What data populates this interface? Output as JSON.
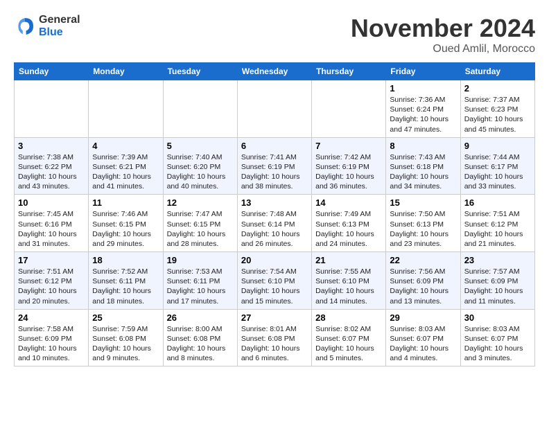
{
  "header": {
    "logo_general": "General",
    "logo_blue": "Blue",
    "month_title": "November 2024",
    "location": "Oued Amlil, Morocco"
  },
  "weekdays": [
    "Sunday",
    "Monday",
    "Tuesday",
    "Wednesday",
    "Thursday",
    "Friday",
    "Saturday"
  ],
  "weeks": [
    [
      {
        "day": "",
        "info": ""
      },
      {
        "day": "",
        "info": ""
      },
      {
        "day": "",
        "info": ""
      },
      {
        "day": "",
        "info": ""
      },
      {
        "day": "",
        "info": ""
      },
      {
        "day": "1",
        "info": "Sunrise: 7:36 AM\nSunset: 6:24 PM\nDaylight: 10 hours and 47 minutes."
      },
      {
        "day": "2",
        "info": "Sunrise: 7:37 AM\nSunset: 6:23 PM\nDaylight: 10 hours and 45 minutes."
      }
    ],
    [
      {
        "day": "3",
        "info": "Sunrise: 7:38 AM\nSunset: 6:22 PM\nDaylight: 10 hours and 43 minutes."
      },
      {
        "day": "4",
        "info": "Sunrise: 7:39 AM\nSunset: 6:21 PM\nDaylight: 10 hours and 41 minutes."
      },
      {
        "day": "5",
        "info": "Sunrise: 7:40 AM\nSunset: 6:20 PM\nDaylight: 10 hours and 40 minutes."
      },
      {
        "day": "6",
        "info": "Sunrise: 7:41 AM\nSunset: 6:19 PM\nDaylight: 10 hours and 38 minutes."
      },
      {
        "day": "7",
        "info": "Sunrise: 7:42 AM\nSunset: 6:19 PM\nDaylight: 10 hours and 36 minutes."
      },
      {
        "day": "8",
        "info": "Sunrise: 7:43 AM\nSunset: 6:18 PM\nDaylight: 10 hours and 34 minutes."
      },
      {
        "day": "9",
        "info": "Sunrise: 7:44 AM\nSunset: 6:17 PM\nDaylight: 10 hours and 33 minutes."
      }
    ],
    [
      {
        "day": "10",
        "info": "Sunrise: 7:45 AM\nSunset: 6:16 PM\nDaylight: 10 hours and 31 minutes."
      },
      {
        "day": "11",
        "info": "Sunrise: 7:46 AM\nSunset: 6:15 PM\nDaylight: 10 hours and 29 minutes."
      },
      {
        "day": "12",
        "info": "Sunrise: 7:47 AM\nSunset: 6:15 PM\nDaylight: 10 hours and 28 minutes."
      },
      {
        "day": "13",
        "info": "Sunrise: 7:48 AM\nSunset: 6:14 PM\nDaylight: 10 hours and 26 minutes."
      },
      {
        "day": "14",
        "info": "Sunrise: 7:49 AM\nSunset: 6:13 PM\nDaylight: 10 hours and 24 minutes."
      },
      {
        "day": "15",
        "info": "Sunrise: 7:50 AM\nSunset: 6:13 PM\nDaylight: 10 hours and 23 minutes."
      },
      {
        "day": "16",
        "info": "Sunrise: 7:51 AM\nSunset: 6:12 PM\nDaylight: 10 hours and 21 minutes."
      }
    ],
    [
      {
        "day": "17",
        "info": "Sunrise: 7:51 AM\nSunset: 6:12 PM\nDaylight: 10 hours and 20 minutes."
      },
      {
        "day": "18",
        "info": "Sunrise: 7:52 AM\nSunset: 6:11 PM\nDaylight: 10 hours and 18 minutes."
      },
      {
        "day": "19",
        "info": "Sunrise: 7:53 AM\nSunset: 6:11 PM\nDaylight: 10 hours and 17 minutes."
      },
      {
        "day": "20",
        "info": "Sunrise: 7:54 AM\nSunset: 6:10 PM\nDaylight: 10 hours and 15 minutes."
      },
      {
        "day": "21",
        "info": "Sunrise: 7:55 AM\nSunset: 6:10 PM\nDaylight: 10 hours and 14 minutes."
      },
      {
        "day": "22",
        "info": "Sunrise: 7:56 AM\nSunset: 6:09 PM\nDaylight: 10 hours and 13 minutes."
      },
      {
        "day": "23",
        "info": "Sunrise: 7:57 AM\nSunset: 6:09 PM\nDaylight: 10 hours and 11 minutes."
      }
    ],
    [
      {
        "day": "24",
        "info": "Sunrise: 7:58 AM\nSunset: 6:09 PM\nDaylight: 10 hours and 10 minutes."
      },
      {
        "day": "25",
        "info": "Sunrise: 7:59 AM\nSunset: 6:08 PM\nDaylight: 10 hours and 9 minutes."
      },
      {
        "day": "26",
        "info": "Sunrise: 8:00 AM\nSunset: 6:08 PM\nDaylight: 10 hours and 8 minutes."
      },
      {
        "day": "27",
        "info": "Sunrise: 8:01 AM\nSunset: 6:08 PM\nDaylight: 10 hours and 6 minutes."
      },
      {
        "day": "28",
        "info": "Sunrise: 8:02 AM\nSunset: 6:07 PM\nDaylight: 10 hours and 5 minutes."
      },
      {
        "day": "29",
        "info": "Sunrise: 8:03 AM\nSunset: 6:07 PM\nDaylight: 10 hours and 4 minutes."
      },
      {
        "day": "30",
        "info": "Sunrise: 8:03 AM\nSunset: 6:07 PM\nDaylight: 10 hours and 3 minutes."
      }
    ]
  ]
}
